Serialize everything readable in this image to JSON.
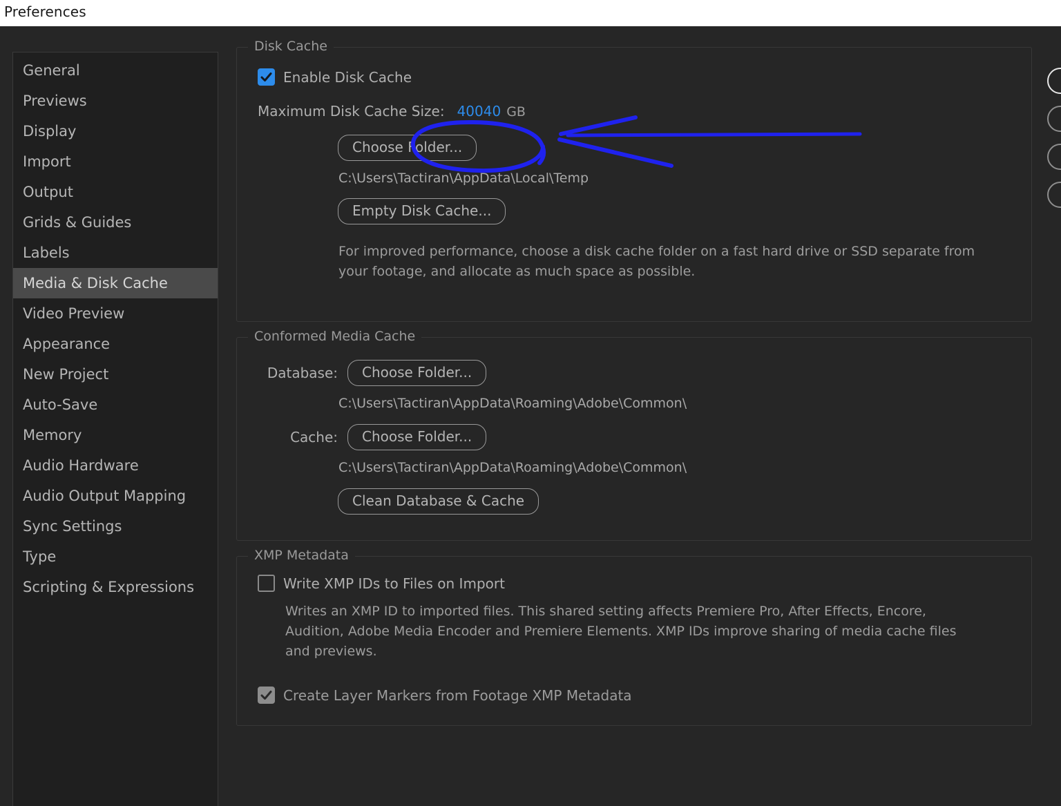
{
  "window": {
    "title": "Preferences"
  },
  "sidebar": {
    "items": [
      {
        "label": "General",
        "selected": false
      },
      {
        "label": "Previews",
        "selected": false
      },
      {
        "label": "Display",
        "selected": false
      },
      {
        "label": "Import",
        "selected": false
      },
      {
        "label": "Output",
        "selected": false
      },
      {
        "label": "Grids & Guides",
        "selected": false
      },
      {
        "label": "Labels",
        "selected": false
      },
      {
        "label": "Media & Disk Cache",
        "selected": true
      },
      {
        "label": "Video Preview",
        "selected": false
      },
      {
        "label": "Appearance",
        "selected": false
      },
      {
        "label": "New Project",
        "selected": false
      },
      {
        "label": "Auto-Save",
        "selected": false
      },
      {
        "label": "Memory",
        "selected": false
      },
      {
        "label": "Audio Hardware",
        "selected": false
      },
      {
        "label": "Audio Output Mapping",
        "selected": false
      },
      {
        "label": "Sync Settings",
        "selected": false
      },
      {
        "label": "Type",
        "selected": false
      },
      {
        "label": "Scripting & Expressions",
        "selected": false
      }
    ]
  },
  "disk_cache": {
    "legend": "Disk Cache",
    "enable_label": "Enable Disk Cache",
    "enable_checked": true,
    "max_size_label": "Maximum Disk Cache Size:",
    "max_size_value": "40040",
    "max_size_unit": "GB",
    "choose_folder_label": "Choose Folder...",
    "folder_path": "C:\\Users\\Tactiran\\AppData\\Local\\Temp",
    "empty_cache_label": "Empty Disk Cache...",
    "help_text": "For improved performance, choose a disk cache folder on a fast hard drive or SSD separate from your footage, and allocate as much space as possible."
  },
  "conformed_media_cache": {
    "legend": "Conformed Media Cache",
    "database_label": "Database:",
    "database_button": "Choose Folder...",
    "database_path": "C:\\Users\\Tactiran\\AppData\\Roaming\\Adobe\\Common\\",
    "cache_label": "Cache:",
    "cache_button": "Choose Folder...",
    "cache_path": "C:\\Users\\Tactiran\\AppData\\Roaming\\Adobe\\Common\\",
    "clean_button": "Clean Database & Cache"
  },
  "xmp_metadata": {
    "legend": "XMP Metadata",
    "write_ids_label": "Write XMP IDs to Files on Import",
    "write_ids_checked": false,
    "write_ids_help": "Writes an XMP ID to imported files. This shared setting affects Premiere Pro, After Effects, Encore, Audition, Adobe Media Encoder and Premiere Elements. XMP IDs improve sharing of media cache files and previews.",
    "layer_markers_label": "Create Layer Markers from Footage XMP Metadata",
    "layer_markers_checked": true,
    "layer_markers_disabled": true
  },
  "colors": {
    "accent_blue": "#2d8ceb",
    "annotation_blue": "#1f22ee",
    "panel_bg": "#262626",
    "sidebar_bg": "#1f1f1f",
    "selected_bg": "#4a4a4a",
    "title_bar_bg": "#ffffff"
  },
  "annotation": {
    "shapes": [
      "ellipse-around-max-disk-cache-size-value",
      "left-pointing-arrow"
    ],
    "color": "#1f22ee"
  }
}
